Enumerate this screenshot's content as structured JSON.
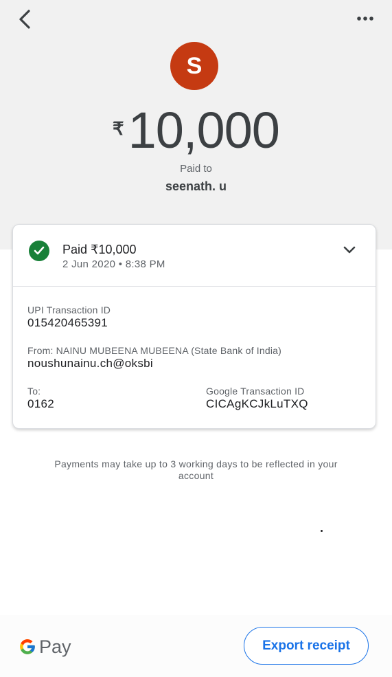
{
  "header": {
    "avatar_initial": "S",
    "currency_symbol": "₹",
    "amount": "10,000",
    "paid_to_label": "Paid to",
    "payee_name": "seenath. u"
  },
  "card": {
    "status_title": "Paid ₹10,000",
    "status_datetime": "2 Jun 2020 • 8:38 PM",
    "upi_label": "UPI Transaction ID",
    "upi_value": "015420465391",
    "from_label": "From: NAINU MUBEENA MUBEENA (State Bank of India)",
    "from_value": "noushunainu.ch@oksbi",
    "to_label": "To:",
    "to_value": "0162",
    "google_txn_label": "Google Transaction ID",
    "google_txn_value": "CICAgKCJkLuTXQ"
  },
  "note": "Payments may take up to 3 working days to be reflected in your account",
  "footer": {
    "brand_text": "Pay",
    "export_label": "Export receipt"
  },
  "colors": {
    "avatar_bg": "#c53a12",
    "success_green": "#188038",
    "accent_blue": "#1a73e8",
    "top_background": "#f1f1f1"
  },
  "icons": [
    "back-arrow-icon",
    "more-options-icon",
    "check-circle-icon",
    "chevron-down-icon",
    "google-g-icon"
  ]
}
